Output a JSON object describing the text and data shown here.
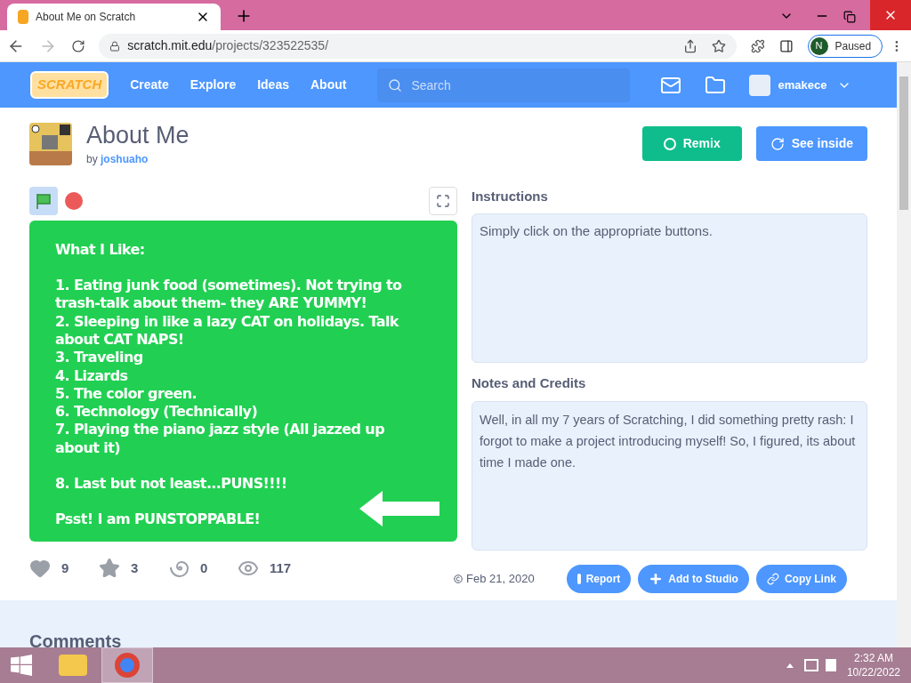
{
  "browser": {
    "tab_title": "About Me on Scratch",
    "url_host": "scratch.mit.edu",
    "url_path": "/projects/323522535/",
    "profile_initial": "N",
    "profile_status": "Paused"
  },
  "nav": {
    "logo": "SCRATCH",
    "links": [
      "Create",
      "Explore",
      "Ideas",
      "About"
    ],
    "search_placeholder": "Search",
    "username": "emakece"
  },
  "project": {
    "title": "About Me",
    "by": "by",
    "author": "joshuaho",
    "remix": "Remix",
    "see_inside": "See inside"
  },
  "stage": {
    "paragraphs": [
      [
        "What I Like:"
      ],
      [
        "1. Eating junk food (sometimes). Not trying to trash-talk about them- they ARE YUMMY!",
        "2. Sleeping in like a lazy CAT on holidays. Talk about CAT NAPS!",
        "3. Traveling",
        "4. Lizards",
        "5. The color green.",
        "6. Technology (Technically)",
        "7. Playing the piano jazz style (All jazzed up about it)"
      ],
      [
        "8. Last but not least...PUNS!!!!"
      ],
      [
        "Psst! I am PUNSTOPPABLE!"
      ]
    ]
  },
  "instructions": {
    "heading": "Instructions",
    "text": "Simply click on the appropriate buttons."
  },
  "notes": {
    "heading": "Notes and Credits",
    "text": "Well, in all my 7 years of Scratching, I did something pretty rash: I forgot to make a project introducing myself! So, I figured, its about time I made one."
  },
  "stats": [
    {
      "kind": "love",
      "count": "9"
    },
    {
      "kind": "favorite",
      "count": "3"
    },
    {
      "kind": "remix",
      "count": "0"
    },
    {
      "kind": "view",
      "count": "117"
    }
  ],
  "date": "Feb 21, 2020",
  "actions": [
    {
      "kind": "report",
      "label": "Report"
    },
    {
      "kind": "studio",
      "label": "Add to Studio"
    },
    {
      "kind": "link",
      "label": "Copy Link"
    }
  ],
  "comments_heading": "Comments",
  "taskbar": {
    "time": "2:32 AM",
    "date": "10/22/2022"
  }
}
